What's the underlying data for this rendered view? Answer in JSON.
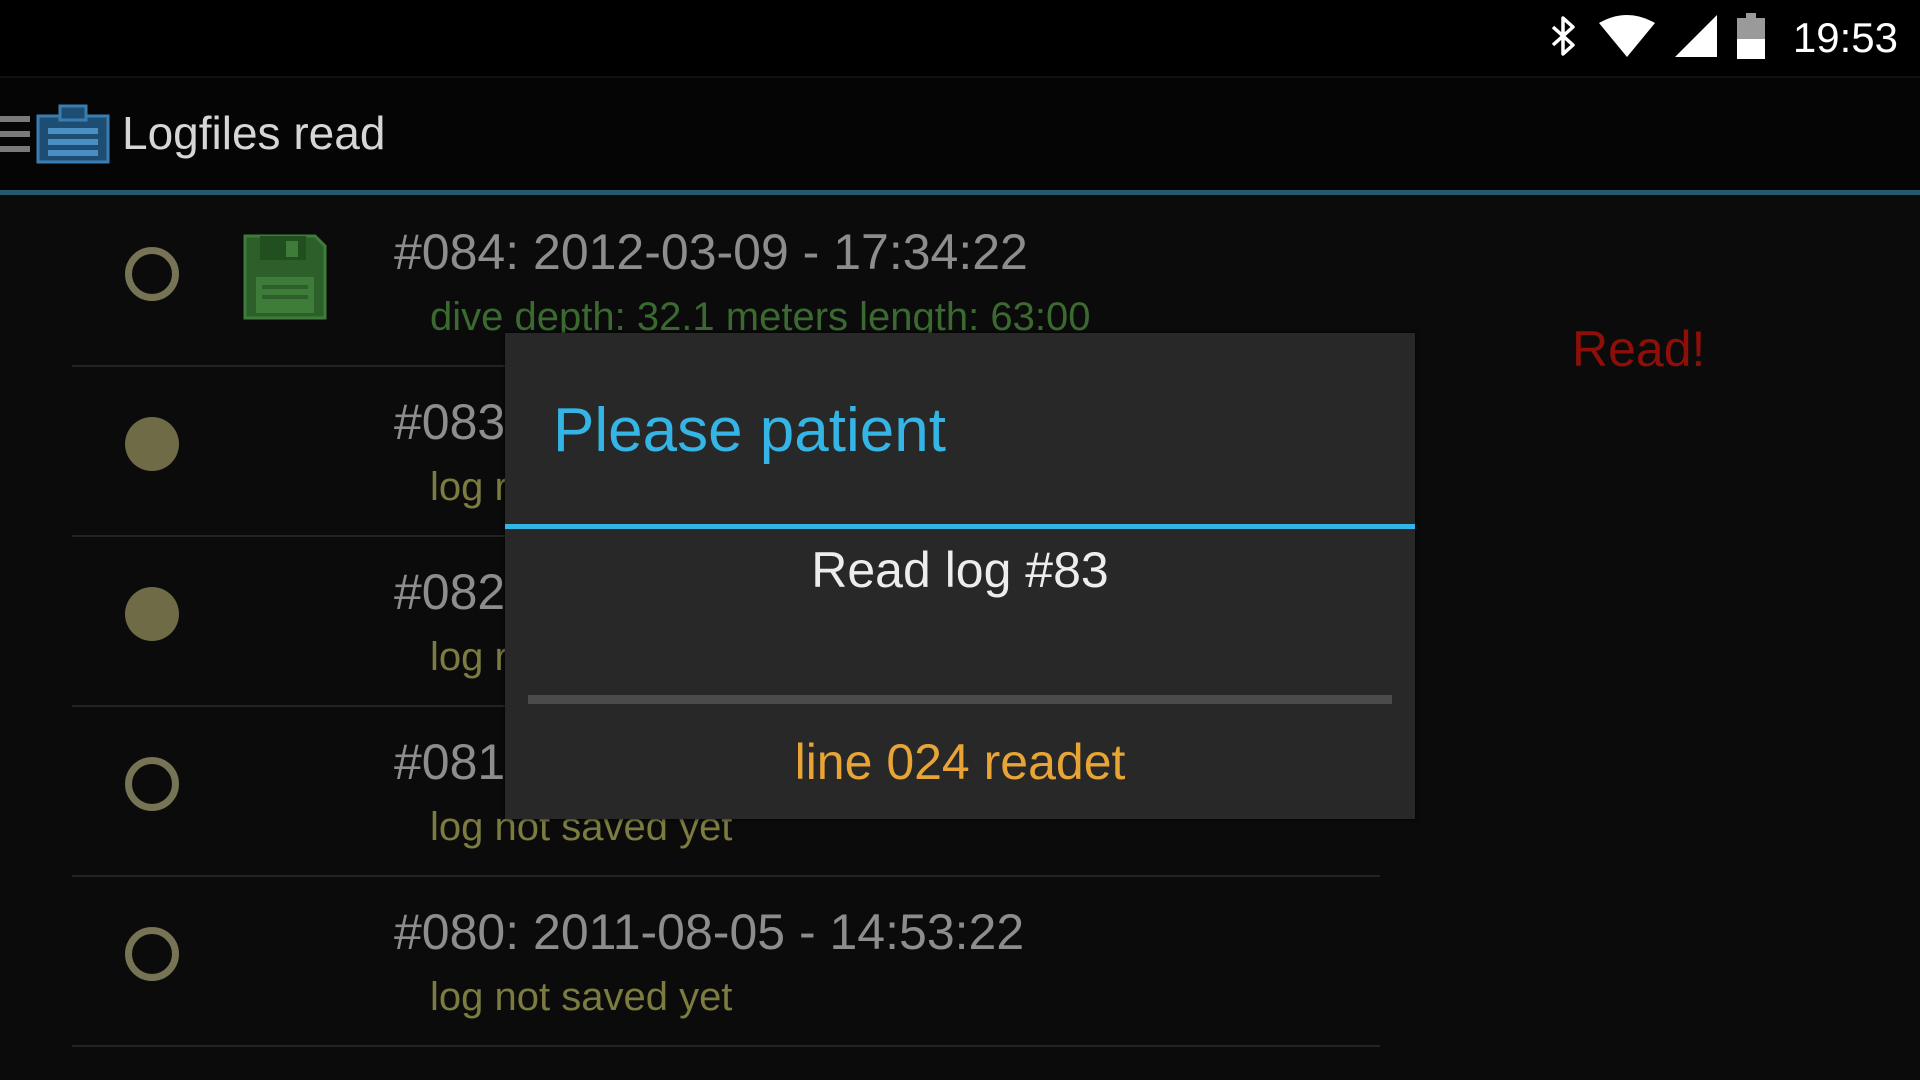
{
  "status_bar": {
    "time": "19:53",
    "icons": [
      "bluetooth-icon",
      "wifi-icon",
      "cell-signal-icon",
      "battery-icon"
    ]
  },
  "action_bar": {
    "title": "Logfiles read",
    "icons": [
      "drawer-icon",
      "app-icon"
    ]
  },
  "logs": [
    {
      "title": "#084: 2012-03-09 - 17:34:22",
      "subtitle": "dive depth: 32.1 meters length: 63:00",
      "radio": "empty",
      "saved": true
    },
    {
      "title": "#083",
      "subtitle": "log r",
      "radio": "filled",
      "saved": false
    },
    {
      "title": "#082",
      "subtitle": "log r",
      "radio": "filled",
      "saved": false
    },
    {
      "title": "#081",
      "subtitle": "log not saved yet",
      "radio": "empty",
      "saved": false
    },
    {
      "title": "#080: 2011-08-05 - 14:53:22",
      "subtitle": "log not saved yet",
      "radio": "empty",
      "saved": false
    }
  ],
  "read_label": "Read!",
  "dialog": {
    "title": "Please patient",
    "message": "Read log #83",
    "progress": 0,
    "status": "line 024 readet"
  },
  "colors": {
    "accent": "#33b5e5",
    "status_text": "#e8a535",
    "read_label": "#8d0f08",
    "saved_text": "#3b6a31",
    "unsaved_text": "#7c7b40"
  }
}
